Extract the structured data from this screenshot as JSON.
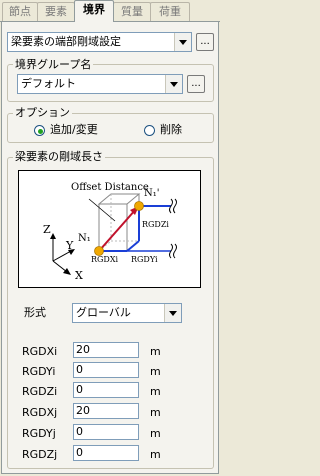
{
  "tabs": [
    {
      "label": "節点",
      "active": false
    },
    {
      "label": "要素",
      "active": false
    },
    {
      "label": "境界",
      "active": true
    },
    {
      "label": "質量",
      "active": false
    },
    {
      "label": "荷重",
      "active": false
    }
  ],
  "function_select": {
    "value": "梁要素の端部剛域設定",
    "more_label": "..."
  },
  "boundary_group": {
    "title": "境界グループ名",
    "value": "デフォルト",
    "more_label": "..."
  },
  "options": {
    "title": "オプション",
    "add_modify": {
      "label": "追加/変更",
      "selected": true
    },
    "delete": {
      "label": "削除",
      "selected": false
    }
  },
  "rigid_length": {
    "title": "梁要素の剛域長さ",
    "diagram": {
      "offset_label": "Offset Distance",
      "n1_label": "N₁",
      "n1p_label": "N₁'",
      "axis_z": "Z",
      "axis_y": "Y",
      "axis_x": "X",
      "rgdzi": "RGDZi",
      "rgdxi": "RGDXi",
      "rgdyi": "RGDYi"
    },
    "format": {
      "label": "形式",
      "value": "グローバル"
    },
    "fields": [
      {
        "label": "RGDXi",
        "value": "20",
        "unit": "m"
      },
      {
        "label": "RGDYi",
        "value": "0",
        "unit": "m"
      },
      {
        "label": "RGDZi",
        "value": "0",
        "unit": "m"
      },
      {
        "label": "RGDXj",
        "value": "20",
        "unit": "m"
      },
      {
        "label": "RGDYj",
        "value": "0",
        "unit": "m"
      },
      {
        "label": "RGDZj",
        "value": "0",
        "unit": "m"
      }
    ]
  }
}
